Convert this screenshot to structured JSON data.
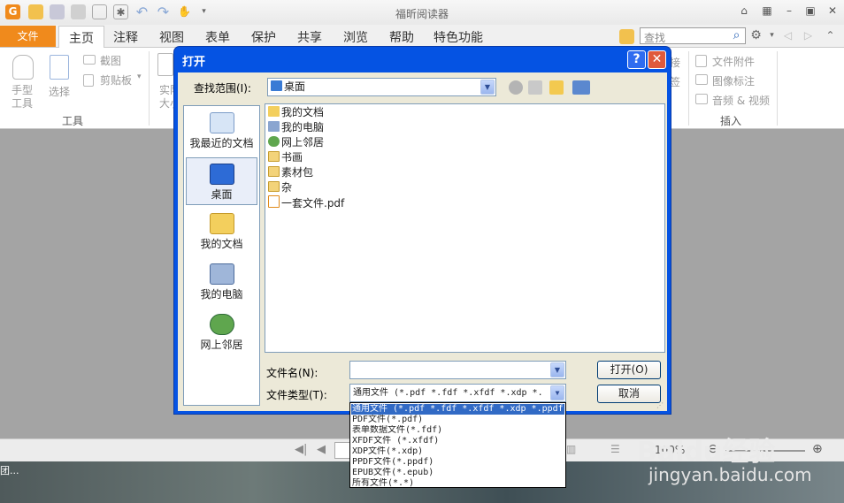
{
  "app": {
    "title": "福昕阅读器"
  },
  "quick_access": [
    "foxit-logo-icon",
    "open-icon",
    "save-icon",
    "print-icon",
    "email-icon",
    "new-icon",
    "undo-icon",
    "redo-icon",
    "hand-icon",
    "more-icon"
  ],
  "ribbon": {
    "file_tab": "文件",
    "tabs": [
      "主页",
      "注释",
      "视图",
      "表单",
      "保护",
      "共享",
      "浏览",
      "帮助",
      "特色功能"
    ],
    "search_placeholder": "查找",
    "hand_tool": "手型\n工具",
    "select_tool": "选择",
    "screenshot": "截图",
    "clipboard": "剪贴板",
    "group_tools": "工具",
    "actual_size": "实际\n大小",
    "attach_file": "文件附件",
    "image_annotation": "图像标注",
    "audio_video": "音频 & 视频",
    "group_insert": "插入",
    "partial_link": "接",
    "partial_link2": "签"
  },
  "dialog": {
    "title": "打开",
    "look_in_label": "查找范围(I):",
    "look_in_value": "桌面",
    "places": [
      "我最近的文档",
      "桌面",
      "我的文档",
      "我的电脑",
      "网上邻居"
    ],
    "files": [
      {
        "name": "我的文档",
        "icon": "my-documents-icon"
      },
      {
        "name": "我的电脑",
        "icon": "my-computer-icon"
      },
      {
        "name": "网上邻居",
        "icon": "network-icon"
      },
      {
        "name": "书画",
        "icon": "folder-icon"
      },
      {
        "name": "素材包",
        "icon": "folder-icon"
      },
      {
        "name": "杂",
        "icon": "folder-icon"
      },
      {
        "name": "一套文件.pdf",
        "icon": "pdf-file-icon"
      }
    ],
    "filename_label": "文件名(N):",
    "filename_value": "",
    "filetype_label": "文件类型(T):",
    "filetype_value": "通用文件 (*.pdf *.fdf *.xfdf *.xdp *.",
    "open_button": "打开(O)",
    "cancel_button": "取消",
    "filetype_options": [
      "通用文件 (*.pdf *.fdf *.xfdf *.xdp *.ppdf",
      "PDF文件(*.pdf)",
      "表单数据文件(*.fdf)",
      "XFDF文件 (*.xfdf)",
      "XDP文件(*.xdp)",
      "PPDF文件(*.ppdf)",
      "EPUB文件(*.epub)",
      "所有文件(*.*)"
    ]
  },
  "status": {
    "zoom": "100%",
    "left_text": "团..."
  },
  "watermark": {
    "brand": "Baidu经验",
    "url": "jingyan.baidu.com"
  }
}
